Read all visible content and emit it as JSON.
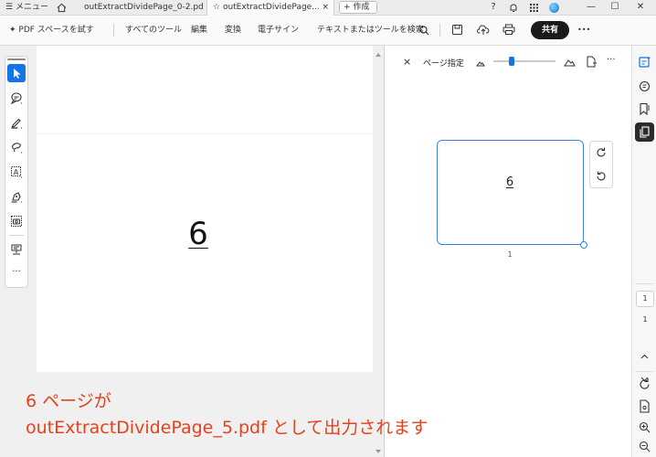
{
  "tabbar": {
    "menu_label": "メニュー",
    "tabs": [
      {
        "label": "outExtractDividePage_0-2.pdf"
      },
      {
        "label": "outExtractDividePage...",
        "close": "×"
      }
    ],
    "new_tab_label": "+ 作成"
  },
  "toolbar": {
    "pdf_space_label": "PDF スペースを試す",
    "menu_items": [
      "すべてのツール",
      "編集",
      "変換",
      "電子サイン"
    ],
    "search_placeholder": "テキストまたはツールを検索",
    "share_label": "共有",
    "more_label": "•••"
  },
  "document": {
    "page_number_text": "6"
  },
  "right_panel": {
    "close_label": "×",
    "page_select_label": "ページ指定",
    "more_label": "···",
    "zoom_fraction": 0.3,
    "thumbnail_text": "6",
    "thumbnail_page_label": "1"
  },
  "navigator": {
    "current_page": "1",
    "total_pages": "1"
  },
  "annotation": {
    "line1": "6 ページが",
    "line2": "outExtractDividePage_5.pdf として出力されます"
  },
  "colors": {
    "accent": "#1473e6",
    "annotation": "#e8411a",
    "thumbnail_border": "#3b82e0"
  }
}
